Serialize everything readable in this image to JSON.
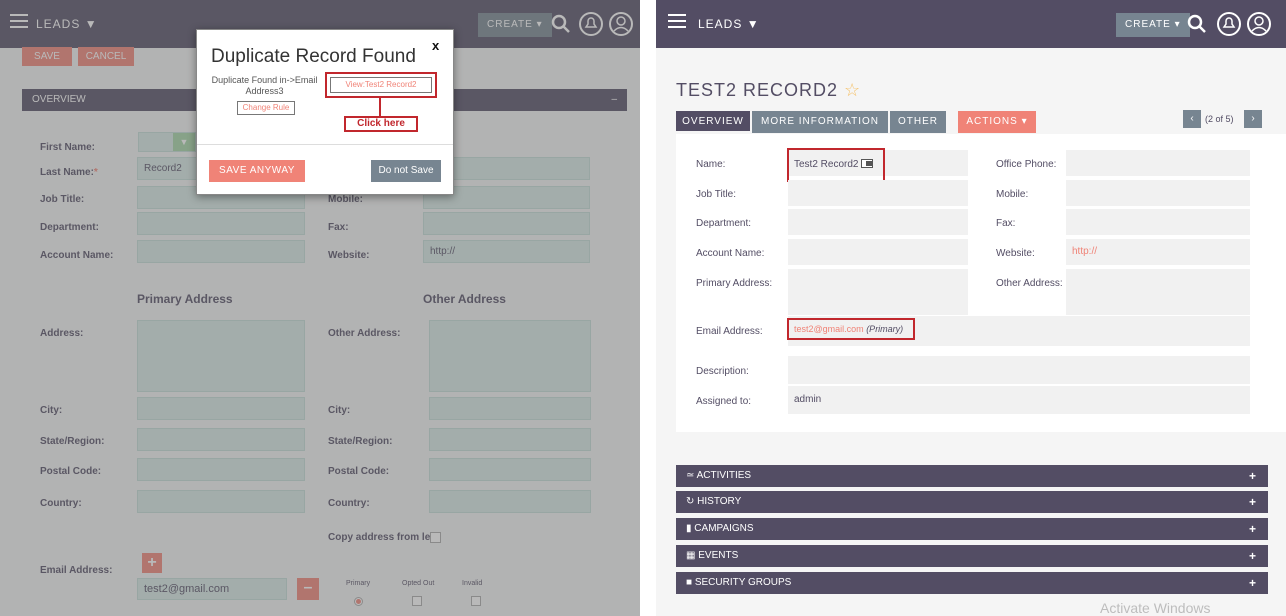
{
  "left": {
    "module": "LEADS",
    "create_label": "CREATE",
    "save_label": "SAVE",
    "cancel_label": "CANCEL",
    "panel_title": "OVERVIEW",
    "panel_collapse": "–",
    "labels": {
      "first_name": "First Name:",
      "last_name": "Last Name:",
      "required": "*",
      "job_title": "Job Title:",
      "department": "Department:",
      "account_name": "Account Name:",
      "mobile": "Mobile:",
      "fax": "Fax:",
      "website": "Website:",
      "primary_address": "Primary Address",
      "other_address": "Other Address",
      "address": "Address:",
      "other_address_field": "Other Address:",
      "city": "City:",
      "state": "State/Region:",
      "postal": "Postal Code:",
      "country": "Country:",
      "copy_address": "Copy address from left:",
      "email_address": "Email Address:",
      "primary": "Primary",
      "opted_out": "Opted Out",
      "invalid": "Invalid"
    },
    "values": {
      "last_name": "Record2",
      "website": "http://",
      "email": "test2@gmail.com"
    }
  },
  "dialog": {
    "title": "Duplicate Record Found",
    "close": "x",
    "found_text": "Duplicate Found in->Email Address3",
    "view_link": "View:Test2 Record2",
    "change_rule": "Change Rule",
    "callout": "Click here",
    "save_anyway": "SAVE ANYWAY",
    "do_not_save": "Do not Save"
  },
  "right": {
    "module": "LEADS",
    "create_label": "CREATE",
    "record_title": "TEST2 RECORD2",
    "tabs": [
      "OVERVIEW",
      "MORE INFORMATION",
      "OTHER",
      "ACTIONS"
    ],
    "pagination": "(2 of 5)",
    "fields": {
      "name_label": "Name:",
      "name_value": "Test2 Record2",
      "office_phone_label": "Office Phone:",
      "job_title_label": "Job Title:",
      "mobile_label": "Mobile:",
      "department_label": "Department:",
      "fax_label": "Fax:",
      "account_name_label": "Account Name:",
      "website_label": "Website:",
      "website_value": "http://",
      "primary_address_label": "Primary Address:",
      "other_address_label": "Other Address:",
      "email_label": "Email Address:",
      "email_value": "test2@gmail.com",
      "email_tag": "(Primary)",
      "description_label": "Description:",
      "assigned_label": "Assigned to:",
      "assigned_value": "admin"
    },
    "subpanels": [
      "ACTIVITIES",
      "HISTORY",
      "CAMPAIGNS",
      "EVENTS",
      "SECURITY GROUPS"
    ],
    "watermark": "Activate Windows"
  },
  "colors": {
    "navbar": "#534d64",
    "accent": "#f08377",
    "highlight": "#c1272d",
    "input_fill": "#d8eae6"
  }
}
